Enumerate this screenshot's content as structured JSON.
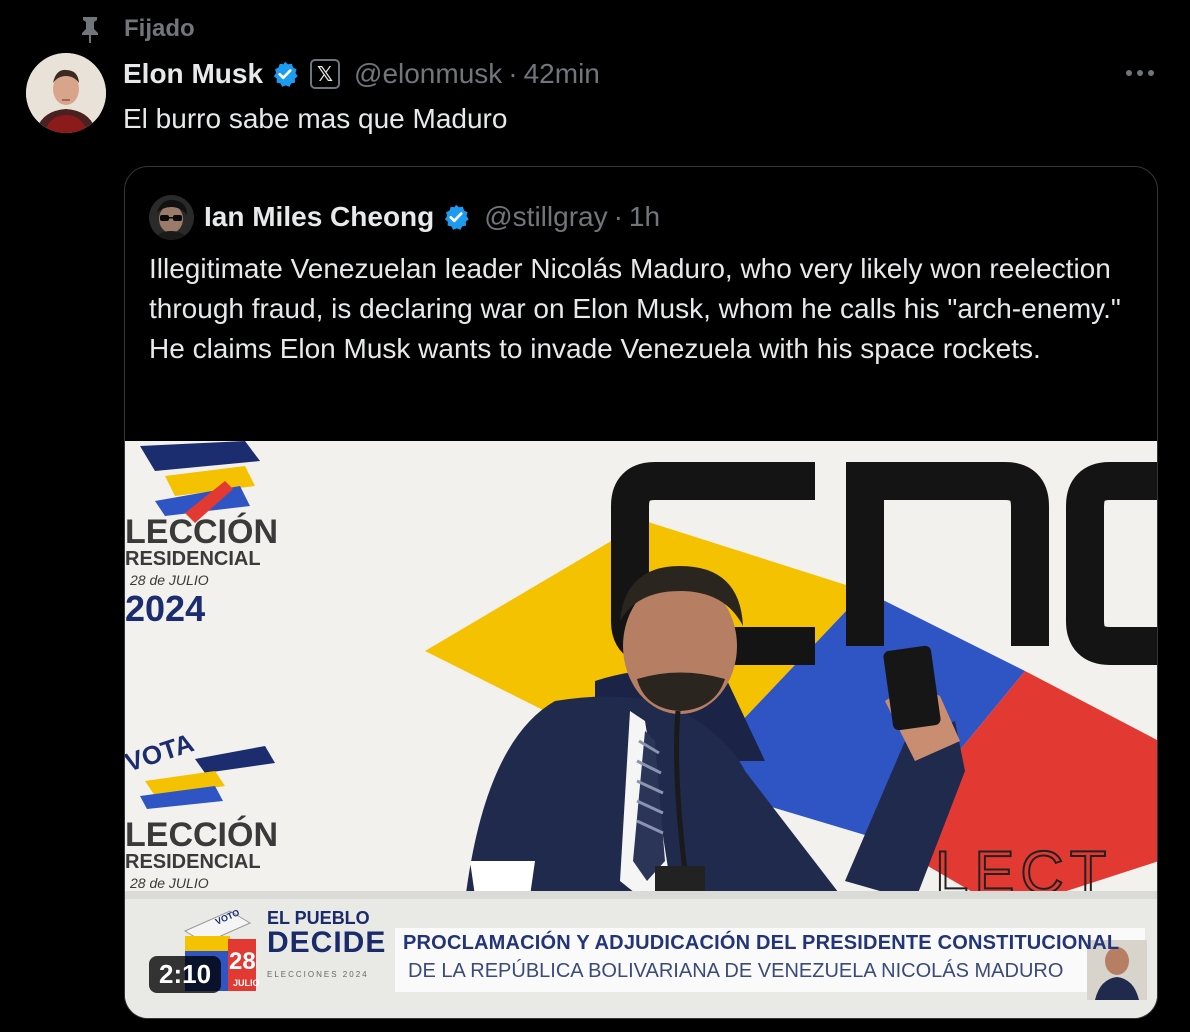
{
  "pinned": {
    "label": "Fijado",
    "icon": "pin-icon"
  },
  "tweet": {
    "author_name": "Elon Musk",
    "handle": "@elonmusk",
    "separator": "·",
    "time": "42min",
    "text": "El burro sabe mas que Maduro",
    "verified_color": "#1d9bf0"
  },
  "quote": {
    "author_name": "Ian Miles Cheong",
    "handle": "@stillgray",
    "separator": "·",
    "time": "1h",
    "text": "Illegitimate Venezuelan leader Nicolás Maduro, who very likely won reelection through fraud, is declaring war on Elon Musk, whom he calls his \"arch-enemy.\" He claims Elon Musk wants to invade Venezuela with his space rockets.",
    "video": {
      "duration": "2:10",
      "banner_line1": "PROCLAMACIÓN Y ADJUDICACIÓN DEL PRESIDENTE CONSTITUCIONAL",
      "banner_line2": "DE LA REPÚBLICA BOLIVARIANA DE VENEZUELA NICOLÁS MADURO",
      "pueblo_line1": "EL PUEBLO",
      "pueblo_line2": "DECIDE",
      "pueblo_line3": "ELECCIONES 2024",
      "badge_number": "28",
      "badge_word": "JULIO",
      "vote_word": "VOTO",
      "top_logo_line1": "LECCIÓN",
      "top_logo_line2": "RESIDENCIAL",
      "top_logo_line3": "28 de JULIO",
      "top_logo_year": "2024",
      "bottom_logo_vote": "VOTA",
      "bottom_logo_line1": "LECCIÓN",
      "bottom_logo_line2": "RESIDENCIAL",
      "bottom_logo_line3": "28 de JULIO",
      "backdrop_text": "CNE",
      "desk_text": "LECT"
    }
  },
  "colors": {
    "background": "#000000",
    "text": "#e7e9ea",
    "secondary": "#71767b",
    "border": "#333639"
  }
}
